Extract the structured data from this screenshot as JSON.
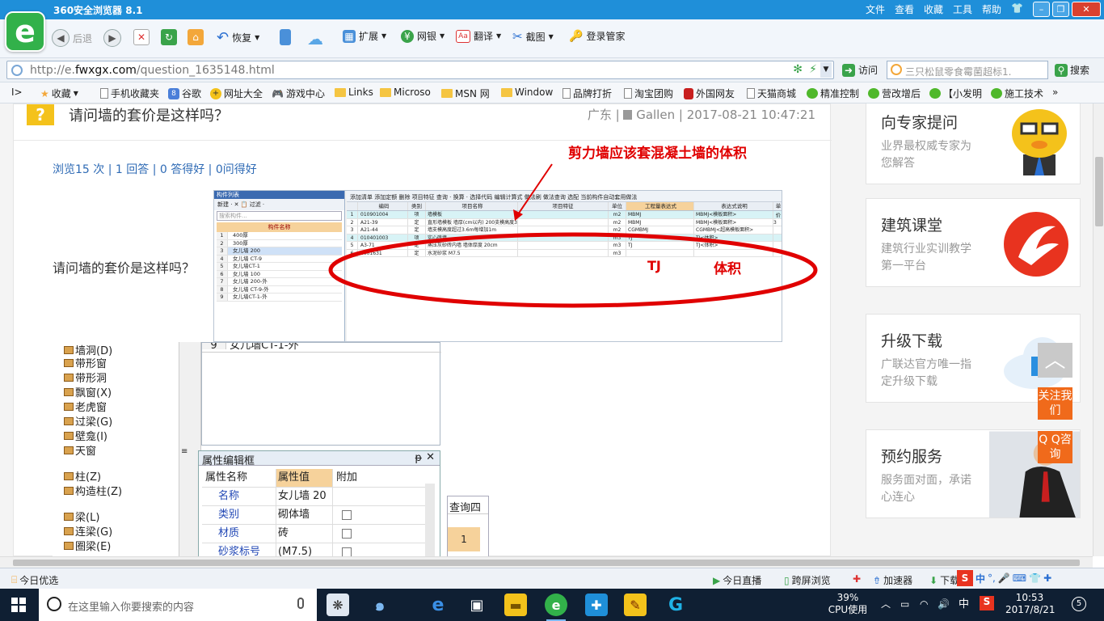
{
  "browser": {
    "title": "360安全浏览器 8.1",
    "menus": [
      "文件",
      "查看",
      "收藏",
      "工具",
      "帮助"
    ],
    "toolbar": {
      "back": "后退",
      "restore": "恢复",
      "extend": "扩展",
      "bank": "网银",
      "translate": "翻译",
      "screenshot": "截图",
      "login": "登录管家"
    },
    "address": {
      "url_prefix": "http://e.",
      "url_domain": "fwxgx.com",
      "url_path": "/question_1635148.html",
      "visit_label": "访问",
      "search_placeholder": "三只松鼠零食霉菌超标1.",
      "search_label": "搜索"
    },
    "favorites": [
      "收藏",
      "手机收藏夹",
      "谷歌",
      "网址大全",
      "游戏中心",
      "Links",
      "Microso",
      "MSN 网",
      "Window",
      "品牌打折",
      "淘宝团购",
      "外国网友",
      "天猫商城",
      "精准控制",
      "营改增后",
      "【小发明",
      "施工技术"
    ]
  },
  "question": {
    "icon": "?",
    "title": "请问墙的套价是这样吗？",
    "meta_region": "广东",
    "meta_user": "Gallen",
    "meta_time": "2017-08-21 10:47:21",
    "stats": "浏览15 次 | 1 回答 | 0 答得好 | 0问得好",
    "body": "请问墙的套价是这样吗？"
  },
  "screenshot1": {
    "left_panel_title": "构件列表",
    "left_panel_tools": "新建 · ✕ 📋 过滤 ·",
    "left_search": "搜索构件...",
    "left_col_header": "构件名称",
    "left_rows": [
      {
        "n": "1",
        "name": "400厚"
      },
      {
        "n": "2",
        "name": "300厚"
      },
      {
        "n": "3",
        "name": "女儿墙 200"
      },
      {
        "n": "4",
        "name": "女儿墙 CT-9"
      },
      {
        "n": "5",
        "name": "女儿墙CT-1"
      },
      {
        "n": "6",
        "name": "女儿墙 100"
      },
      {
        "n": "7",
        "name": "女儿墙 200-外"
      },
      {
        "n": "8",
        "name": "女儿墙 CT-9-外"
      },
      {
        "n": "9",
        "name": "女儿墙CT-1-外"
      }
    ],
    "right_tools": "添加清单  添加定额  删除  项目特征  查询 · 换算 ·  选择代码  编辑计算式  做法刷  做法查询  选配  当前构件自动套用做法",
    "grid_headers": [
      "",
      "编码",
      "类别",
      "项目名称",
      "项目特征",
      "单位",
      "工程量表达式",
      "表达式说明",
      "单价"
    ],
    "grid_rows": [
      {
        "n": "1",
        "code": "010901004",
        "type": "项",
        "name": "墙模板",
        "feat": "",
        "unit": "m2",
        "expr": "MBMJ",
        "desc": "MBMJ<模板面积>",
        "price": "",
        "hl": true
      },
      {
        "n": "2",
        "code": "A21-39",
        "type": "定",
        "name": "直形墙模板 墙厚(cm以内) 200支模高度3.6m内",
        "feat": "",
        "unit": "m2",
        "expr": "MBMJ",
        "desc": "MBMJ<模板面积>",
        "price": "3",
        "hl": false
      },
      {
        "n": "3",
        "code": "A21-44",
        "type": "定",
        "name": "墙支模高度超过3.6m每增加1m",
        "feat": "",
        "unit": "m2",
        "expr": "CGMBMJ",
        "desc": "CGMBMJ<超高模板面积>",
        "price": "",
        "hl": false
      },
      {
        "n": "4",
        "code": "010401003",
        "type": "项",
        "name": "实心砖墙",
        "feat": "",
        "unit": "m3",
        "expr": "TJ",
        "desc": "TJ<体积>",
        "price": "",
        "hl": true
      },
      {
        "n": "5",
        "code": "A3-71",
        "type": "定",
        "name": "蒸压灰砂砖内墙 墙体厚度 20cm",
        "feat": "",
        "unit": "m3",
        "expr": "TJ",
        "desc": "TJ<体积>",
        "price": "",
        "hl": false
      },
      {
        "n": "6",
        "code": "8001631",
        "type": "定",
        "name": "水泥砂浆 M7.5",
        "feat": "",
        "unit": "m3",
        "expr": "",
        "desc": "",
        "price": "",
        "hl": false
      }
    ],
    "annotation_top": "剪力墙应该套混凝土墙的体积",
    "annotation_tj": "TJ",
    "annotation_volume": "体积"
  },
  "screenshot2": {
    "tree_items": [
      "墙洞(D)",
      "带形窗",
      "带形洞",
      "飘窗(X)",
      "老虎窗",
      "过梁(G)",
      "壁龛(I)",
      "天窗",
      "柱(Z)",
      "构造柱(Z)",
      "梁(L)",
      "连梁(G)",
      "圈梁(E)"
    ],
    "list_row_n": "9",
    "list_row_name": "女儿墙CT-1-外",
    "prop_title": "属性编辑框",
    "prop_headers": {
      "name": "属性名称",
      "value": "属性值",
      "extra": "附加"
    },
    "prop_rows": [
      {
        "name": "名称",
        "value": "女儿墙 20"
      },
      {
        "name": "类别",
        "value": "砌体墙"
      },
      {
        "name": "材质",
        "value": "砖"
      },
      {
        "name": "砂浆标号",
        "value": "(M7.5)"
      }
    ],
    "query_title": "查询四",
    "query_row": "1"
  },
  "sidebar": {
    "expert": {
      "title": "向专家提问",
      "desc": "业界最权威专家为您解答"
    },
    "school": {
      "title": "建筑课堂",
      "desc": "建筑行业实训教学第一平台"
    },
    "upgrade": {
      "title": "升级下载",
      "desc": "广联达官方唯一指定升级下载"
    },
    "booking": {
      "title": "预约服务",
      "desc": "服务面对面，承诺心连心"
    },
    "follow_btn": "关注我们",
    "qq_btn": "Q Q咨询"
  },
  "statusbar": {
    "today_pick": "今日优选",
    "live": "今日直播",
    "cross_screen": "跨屏浏览",
    "accelerator": "加速器",
    "download": "下载",
    "ime": "中"
  },
  "taskbar": {
    "search_placeholder": "在这里输入你要搜索的内容",
    "cpu_percent": "39%",
    "cpu_label": "CPU使用",
    "ime": "中",
    "time": "10:53",
    "date": "2017/8/21",
    "notifications": "5"
  },
  "colors": {
    "title_bar": "#1f8fd9",
    "annotation_red": "#e00000",
    "link_blue": "#2f6bb5",
    "float_orange": "#f06a1b"
  }
}
